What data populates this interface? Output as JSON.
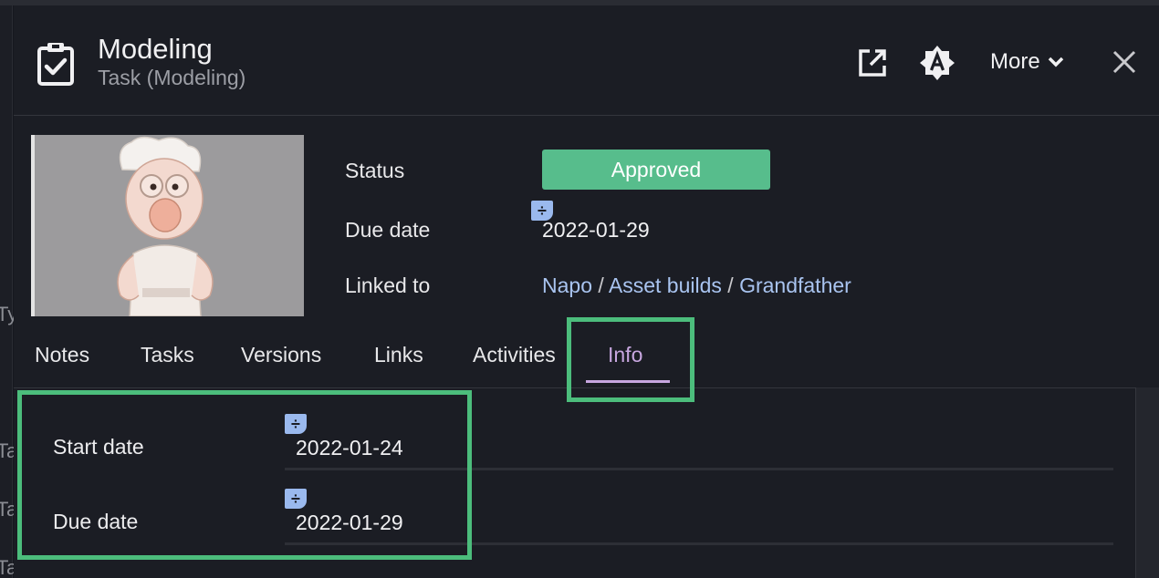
{
  "header": {
    "title": "Modeling",
    "subtitle": "Task (Modeling)",
    "more_label": "More",
    "icons": [
      "task-clipboard-icon",
      "open-external-icon",
      "badge-a-icon",
      "chevron-down-icon",
      "close-icon"
    ]
  },
  "left_fragments": [
    "Ty",
    "Ta",
    "Ta",
    "Ta"
  ],
  "summary": {
    "status_label": "Status",
    "status_value": "Approved",
    "status_color": "#57bd8c",
    "due_label": "Due date",
    "due_value": "2022-01-29",
    "linked_label": "Linked to",
    "linked": [
      "Napo",
      "Asset builds",
      "Grandfather"
    ],
    "link_separator": "/"
  },
  "tabs": [
    {
      "label": "Notes"
    },
    {
      "label": "Tasks"
    },
    {
      "label": "Versions"
    },
    {
      "label": "Links"
    },
    {
      "label": "Activities"
    },
    {
      "label": "Info",
      "active": true
    }
  ],
  "info": {
    "start_label": "Start date",
    "start_value": "2022-01-24",
    "due_label": "Due date",
    "due_value": "2022-01-29"
  },
  "colors": {
    "highlight": "#4cbd7c",
    "active_tab": "#c8a7e0",
    "link": "#a9c4f0",
    "calc_icon": "#9ab9ee"
  }
}
